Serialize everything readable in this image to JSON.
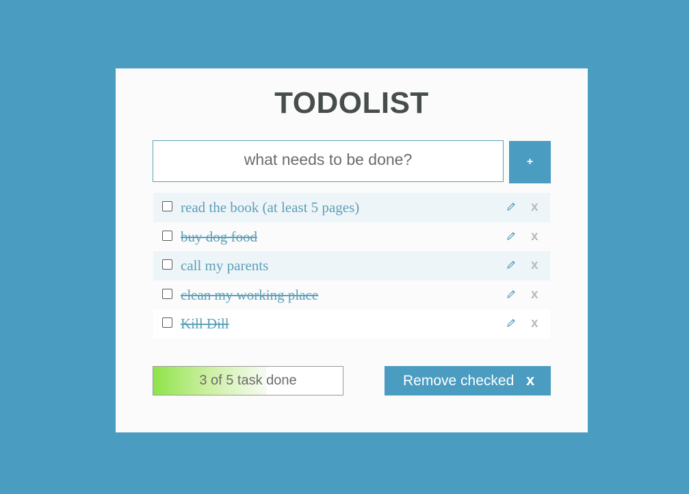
{
  "app": {
    "title": "TODOLIST"
  },
  "input": {
    "placeholder": "what needs to be done?",
    "value": ""
  },
  "add_button": {
    "label": "+"
  },
  "tasks": [
    {
      "text": "read the book (at least 5 pages)",
      "checked": false,
      "struck": false,
      "edit_icon": "pencil-icon",
      "delete_label": "x"
    },
    {
      "text": "buy dog food",
      "checked": false,
      "struck": true,
      "edit_icon": "pencil-icon",
      "delete_label": "x"
    },
    {
      "text": "call my parents",
      "checked": false,
      "struck": false,
      "edit_icon": "pencil-icon",
      "delete_label": "x"
    },
    {
      "text": "clean my working place",
      "checked": false,
      "struck": true,
      "edit_icon": "pencil-icon",
      "delete_label": "x"
    },
    {
      "text": "Kill Dill",
      "checked": false,
      "struck": true,
      "edit_icon": "pencil-icon",
      "delete_label": "x"
    }
  ],
  "progress": {
    "text": "3 of 5 task done",
    "done": 3,
    "total": 5,
    "fraction": 0.6
  },
  "remove_button": {
    "label": "Remove checked",
    "icon_label": "x"
  },
  "colors": {
    "background": "#4a9cc1",
    "card": "#fbfbfb",
    "title": "#474d4a",
    "task_text": "#5b9fb8",
    "delete": "#b9b9b9",
    "progress_fill": "#8fe34a"
  }
}
